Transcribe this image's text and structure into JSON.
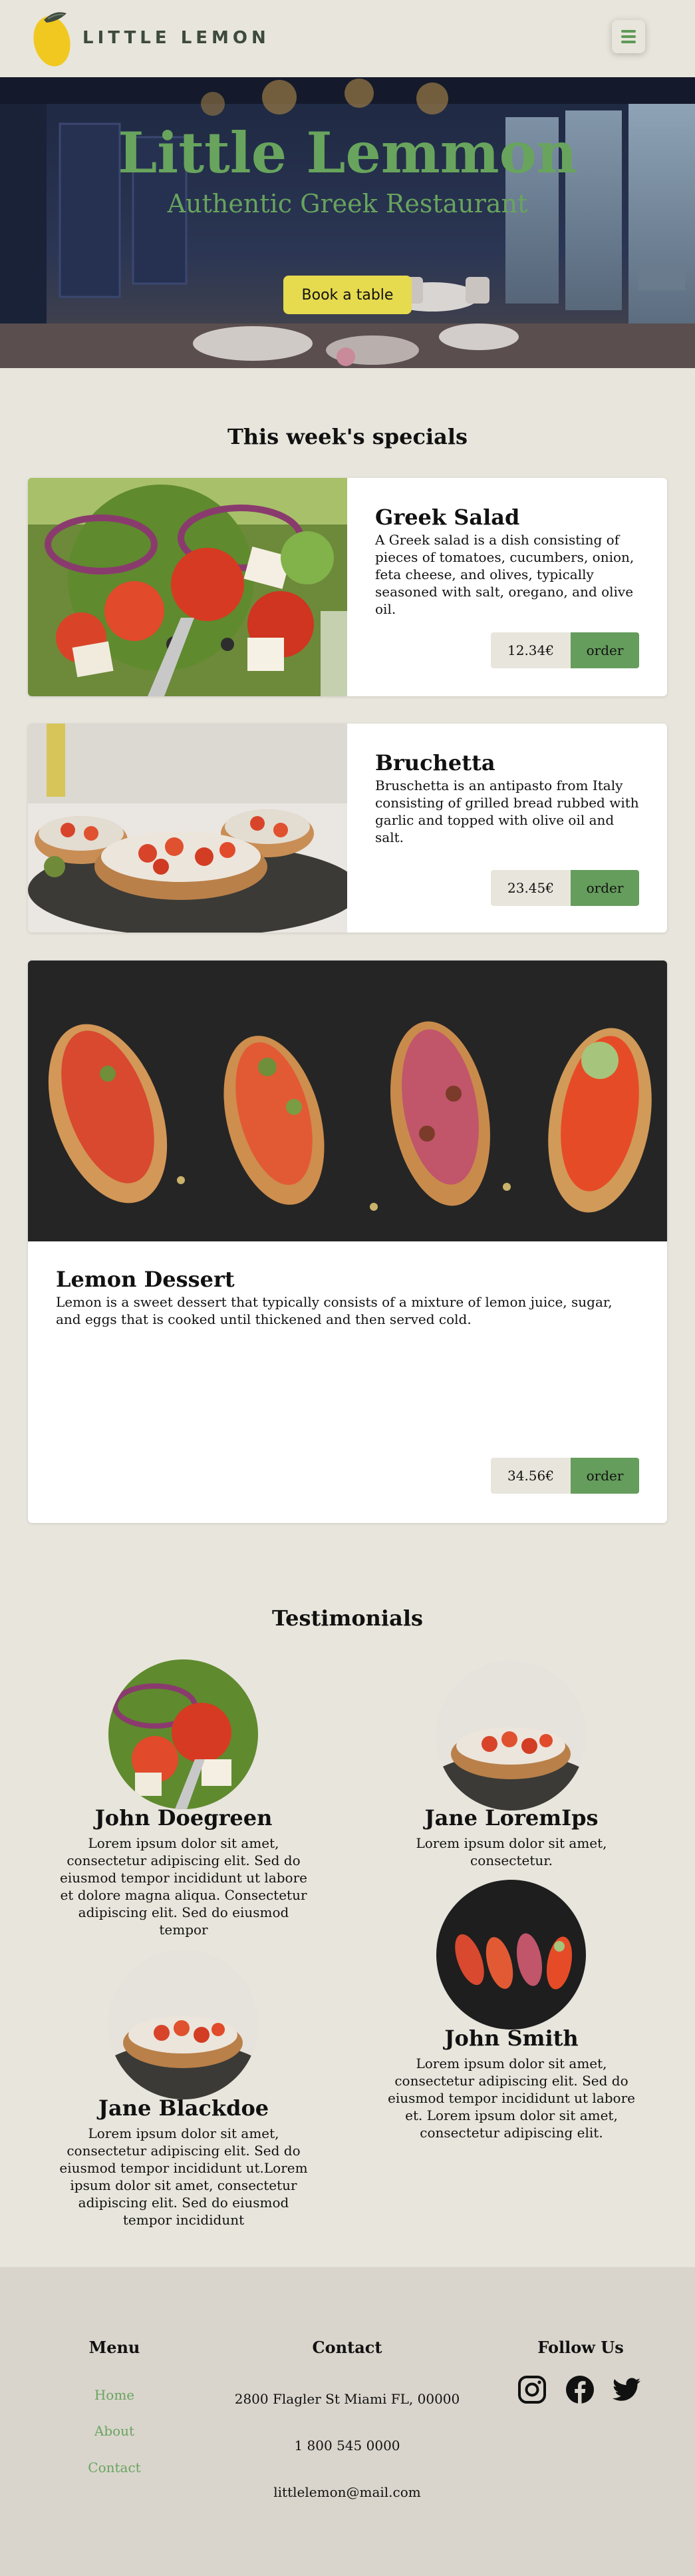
{
  "header": {
    "logo_text": "LITTLE LEMON",
    "menu_icon": "hamburger-icon"
  },
  "hero": {
    "title": "Little Lemmon",
    "subtitle": "Authentic Greek Restaurant",
    "cta_label": "Book a table"
  },
  "specials": {
    "title": "This week's specials",
    "items": [
      {
        "name": "Greek Salad",
        "description": "A Greek salad is a dish consisting of pieces of tomatoes, cucumbers, onion, feta cheese, and olives, typically seasoned with salt, oregano, and olive oil.",
        "price": "12.34€",
        "order_label": "order"
      },
      {
        "name": "Bruchetta",
        "description": "Bruschetta is an antipasto from Italy consisting of grilled bread rubbed with garlic and topped with olive oil and salt.",
        "price": "23.45€",
        "order_label": "order"
      },
      {
        "name": "Lemon Dessert",
        "description": "Lemon is a sweet dessert that typically consists of a mixture of lemon juice, sugar, and eggs that is cooked until thickened and then served cold.",
        "price": "34.56€",
        "order_label": "order"
      }
    ]
  },
  "testimonials": {
    "title": "Testimonials",
    "items": [
      {
        "name": "John Doegreen",
        "text": "Lorem ipsum dolor sit amet, consectetur adipiscing elit. Sed do eiusmod tempor incididunt ut labore et dolore magna aliqua. Consectetur adipiscing elit. Sed do eiusmod tempor"
      },
      {
        "name": "Jane LoremIps",
        "text": "Lorem ipsum dolor sit amet, consectetur."
      },
      {
        "name": "Jane Blackdoe",
        "text": "Lorem ipsum dolor sit amet, consectetur adipiscing elit. Sed do eiusmod tempor incididunt ut.Lorem ipsum dolor sit amet, consectetur adipiscing elit. Sed do eiusmod tempor incididunt"
      },
      {
        "name": "John Smith",
        "text": "Lorem ipsum dolor sit amet, consectetur adipiscing elit. Sed do eiusmod tempor incididunt ut labore et. Lorem ipsum dolor sit amet, consectetur adipiscing elit."
      }
    ]
  },
  "footer": {
    "menu_title": "Menu",
    "menu_links": [
      "Home",
      "About",
      "Contact"
    ],
    "contact_title": "Contact",
    "address": "2800 Flagler St Miami FL, 00000",
    "phone": "1 800 545 0000",
    "email": "littlelemon@mail.com",
    "follow_title": "Follow Us",
    "social_icons": [
      "instagram-icon",
      "facebook-icon",
      "twitter-icon"
    ]
  },
  "colors": {
    "background": "#e8e5dc",
    "accent_green": "#659d5c",
    "cta_yellow": "#e6da4f",
    "footer_bg": "#d9d5cc"
  }
}
